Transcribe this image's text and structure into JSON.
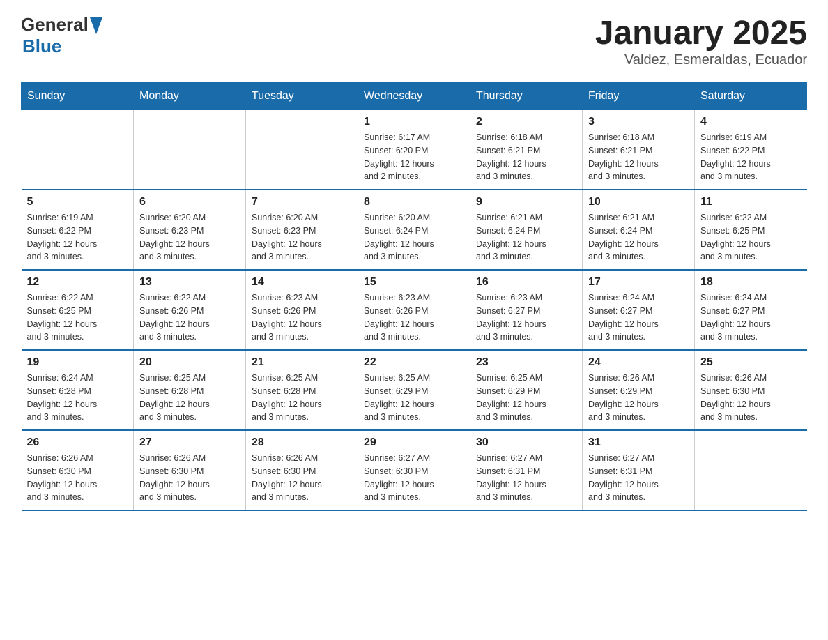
{
  "header": {
    "logo_general": "General",
    "logo_blue": "Blue",
    "title": "January 2025",
    "subtitle": "Valdez, Esmeraldas, Ecuador"
  },
  "weekdays": [
    "Sunday",
    "Monday",
    "Tuesday",
    "Wednesday",
    "Thursday",
    "Friday",
    "Saturday"
  ],
  "weeks": [
    [
      {
        "day": "",
        "info": ""
      },
      {
        "day": "",
        "info": ""
      },
      {
        "day": "",
        "info": ""
      },
      {
        "day": "1",
        "info": "Sunrise: 6:17 AM\nSunset: 6:20 PM\nDaylight: 12 hours\nand 2 minutes."
      },
      {
        "day": "2",
        "info": "Sunrise: 6:18 AM\nSunset: 6:21 PM\nDaylight: 12 hours\nand 3 minutes."
      },
      {
        "day": "3",
        "info": "Sunrise: 6:18 AM\nSunset: 6:21 PM\nDaylight: 12 hours\nand 3 minutes."
      },
      {
        "day": "4",
        "info": "Sunrise: 6:19 AM\nSunset: 6:22 PM\nDaylight: 12 hours\nand 3 minutes."
      }
    ],
    [
      {
        "day": "5",
        "info": "Sunrise: 6:19 AM\nSunset: 6:22 PM\nDaylight: 12 hours\nand 3 minutes."
      },
      {
        "day": "6",
        "info": "Sunrise: 6:20 AM\nSunset: 6:23 PM\nDaylight: 12 hours\nand 3 minutes."
      },
      {
        "day": "7",
        "info": "Sunrise: 6:20 AM\nSunset: 6:23 PM\nDaylight: 12 hours\nand 3 minutes."
      },
      {
        "day": "8",
        "info": "Sunrise: 6:20 AM\nSunset: 6:24 PM\nDaylight: 12 hours\nand 3 minutes."
      },
      {
        "day": "9",
        "info": "Sunrise: 6:21 AM\nSunset: 6:24 PM\nDaylight: 12 hours\nand 3 minutes."
      },
      {
        "day": "10",
        "info": "Sunrise: 6:21 AM\nSunset: 6:24 PM\nDaylight: 12 hours\nand 3 minutes."
      },
      {
        "day": "11",
        "info": "Sunrise: 6:22 AM\nSunset: 6:25 PM\nDaylight: 12 hours\nand 3 minutes."
      }
    ],
    [
      {
        "day": "12",
        "info": "Sunrise: 6:22 AM\nSunset: 6:25 PM\nDaylight: 12 hours\nand 3 minutes."
      },
      {
        "day": "13",
        "info": "Sunrise: 6:22 AM\nSunset: 6:26 PM\nDaylight: 12 hours\nand 3 minutes."
      },
      {
        "day": "14",
        "info": "Sunrise: 6:23 AM\nSunset: 6:26 PM\nDaylight: 12 hours\nand 3 minutes."
      },
      {
        "day": "15",
        "info": "Sunrise: 6:23 AM\nSunset: 6:26 PM\nDaylight: 12 hours\nand 3 minutes."
      },
      {
        "day": "16",
        "info": "Sunrise: 6:23 AM\nSunset: 6:27 PM\nDaylight: 12 hours\nand 3 minutes."
      },
      {
        "day": "17",
        "info": "Sunrise: 6:24 AM\nSunset: 6:27 PM\nDaylight: 12 hours\nand 3 minutes."
      },
      {
        "day": "18",
        "info": "Sunrise: 6:24 AM\nSunset: 6:27 PM\nDaylight: 12 hours\nand 3 minutes."
      }
    ],
    [
      {
        "day": "19",
        "info": "Sunrise: 6:24 AM\nSunset: 6:28 PM\nDaylight: 12 hours\nand 3 minutes."
      },
      {
        "day": "20",
        "info": "Sunrise: 6:25 AM\nSunset: 6:28 PM\nDaylight: 12 hours\nand 3 minutes."
      },
      {
        "day": "21",
        "info": "Sunrise: 6:25 AM\nSunset: 6:28 PM\nDaylight: 12 hours\nand 3 minutes."
      },
      {
        "day": "22",
        "info": "Sunrise: 6:25 AM\nSunset: 6:29 PM\nDaylight: 12 hours\nand 3 minutes."
      },
      {
        "day": "23",
        "info": "Sunrise: 6:25 AM\nSunset: 6:29 PM\nDaylight: 12 hours\nand 3 minutes."
      },
      {
        "day": "24",
        "info": "Sunrise: 6:26 AM\nSunset: 6:29 PM\nDaylight: 12 hours\nand 3 minutes."
      },
      {
        "day": "25",
        "info": "Sunrise: 6:26 AM\nSunset: 6:30 PM\nDaylight: 12 hours\nand 3 minutes."
      }
    ],
    [
      {
        "day": "26",
        "info": "Sunrise: 6:26 AM\nSunset: 6:30 PM\nDaylight: 12 hours\nand 3 minutes."
      },
      {
        "day": "27",
        "info": "Sunrise: 6:26 AM\nSunset: 6:30 PM\nDaylight: 12 hours\nand 3 minutes."
      },
      {
        "day": "28",
        "info": "Sunrise: 6:26 AM\nSunset: 6:30 PM\nDaylight: 12 hours\nand 3 minutes."
      },
      {
        "day": "29",
        "info": "Sunrise: 6:27 AM\nSunset: 6:30 PM\nDaylight: 12 hours\nand 3 minutes."
      },
      {
        "day": "30",
        "info": "Sunrise: 6:27 AM\nSunset: 6:31 PM\nDaylight: 12 hours\nand 3 minutes."
      },
      {
        "day": "31",
        "info": "Sunrise: 6:27 AM\nSunset: 6:31 PM\nDaylight: 12 hours\nand 3 minutes."
      },
      {
        "day": "",
        "info": ""
      }
    ]
  ]
}
